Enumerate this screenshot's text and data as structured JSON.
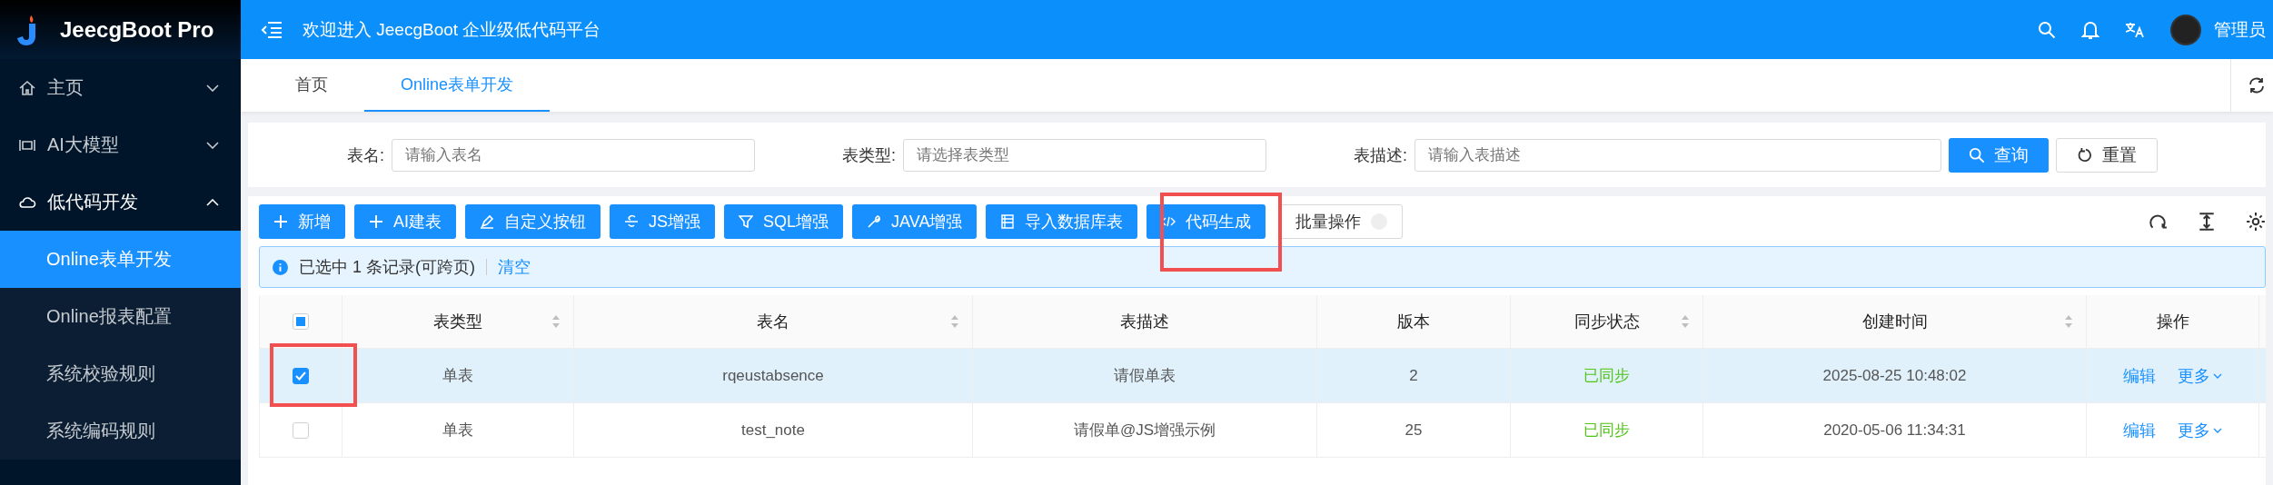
{
  "sidebar": {
    "brand": "JeecgBoot Pro",
    "items": [
      {
        "label": "主页",
        "expanded": false
      },
      {
        "label": "AI大模型",
        "expanded": false
      },
      {
        "label": "低代码开发",
        "expanded": true,
        "children": [
          {
            "label": "Online表单开发",
            "selected": true
          },
          {
            "label": "Online报表配置",
            "selected": false
          },
          {
            "label": "系统校验规则",
            "selected": false
          },
          {
            "label": "系统编码规则",
            "selected": false
          }
        ]
      }
    ]
  },
  "header": {
    "title": "欢迎进入 JeecgBoot 企业级低代码平台",
    "user": "管理员"
  },
  "tabs": [
    {
      "label": "首页",
      "selected": false
    },
    {
      "label": "Online表单开发",
      "selected": true
    }
  ],
  "search": {
    "fields": [
      {
        "label": "表名:",
        "placeholder": "请输入表名"
      },
      {
        "label": "表类型:",
        "placeholder": "请选择表类型"
      },
      {
        "label": "表描述:",
        "placeholder": "请输入表描述"
      }
    ],
    "buttons": [
      {
        "label": "查询",
        "kind": "primary"
      },
      {
        "label": "重置",
        "kind": "default"
      }
    ]
  },
  "toolbar": {
    "buttons": [
      {
        "label": "新增",
        "kind": "primary"
      },
      {
        "label": "AI建表",
        "kind": "primary"
      },
      {
        "label": "自定义按钮",
        "kind": "primary"
      },
      {
        "label": "JS增强",
        "kind": "primary"
      },
      {
        "label": "SQL增强",
        "kind": "primary"
      },
      {
        "label": "JAVA增强",
        "kind": "primary"
      },
      {
        "label": "导入数据库表",
        "kind": "primary"
      },
      {
        "label": "代码生成",
        "kind": "primary"
      },
      {
        "label": "批量操作",
        "kind": "default"
      }
    ]
  },
  "alert": {
    "text": "已选中 1 条记录(可跨页)",
    "link": "清空"
  },
  "table": {
    "select_all": {
      "indeterminate": true
    },
    "columns": [
      {
        "label": "表类型",
        "sortable": true
      },
      {
        "label": "表名",
        "sortable": true
      },
      {
        "label": "表描述",
        "sortable": false
      },
      {
        "label": "版本",
        "sortable": false
      },
      {
        "label": "同步状态",
        "sortable": true
      },
      {
        "label": "创建时间",
        "sortable": true
      },
      {
        "label": "操作",
        "sortable": false
      }
    ],
    "rows": [
      {
        "selected": true,
        "cells": [
          "单表",
          "rqeustabsence",
          "请假单表",
          "2",
          "已同步",
          "2025-08-25 10:48:02"
        ],
        "actions": [
          "编辑",
          "更多"
        ]
      },
      {
        "selected": false,
        "cells": [
          "单表",
          "test_note",
          "请假单@JS增强示例",
          "25",
          "已同步",
          "2020-05-06 11:34:31"
        ],
        "actions": [
          "编辑",
          "更多"
        ]
      }
    ]
  }
}
